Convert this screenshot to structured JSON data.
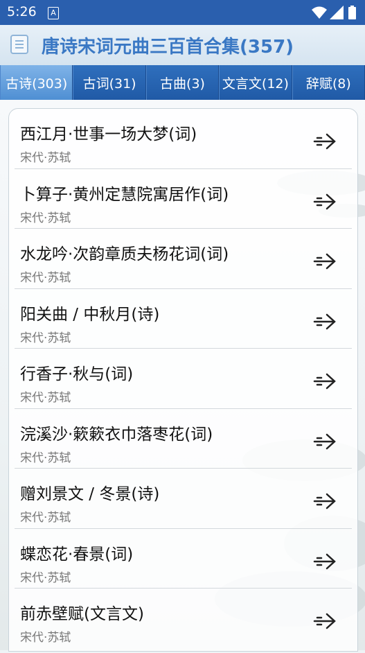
{
  "status_bar": {
    "time": "5:26",
    "notification_icon": "A"
  },
  "app": {
    "title": "唐诗宋词元曲三百首合集(357)"
  },
  "tabs": [
    {
      "label": "古诗(303)",
      "active": true
    },
    {
      "label": "古词(31)",
      "active": false
    },
    {
      "label": "古曲(3)",
      "active": false
    },
    {
      "label": "文言文(12)",
      "active": false
    },
    {
      "label": "辞赋(8)",
      "active": false
    }
  ],
  "items": [
    {
      "title": "西江月·世事一场大梦(词)",
      "author": "宋代·苏轼"
    },
    {
      "title": "卜算子·黄州定慧院寓居作(词)",
      "author": "宋代·苏轼"
    },
    {
      "title": "水龙吟·次韵章质夫杨花词(词)",
      "author": "宋代·苏轼"
    },
    {
      "title": "阳关曲 / 中秋月(诗)",
      "author": "宋代·苏轼"
    },
    {
      "title": "行香子·秋与(词)",
      "author": "宋代·苏轼"
    },
    {
      "title": "浣溪沙·簌簌衣巾落枣花(词)",
      "author": "宋代·苏轼"
    },
    {
      "title": "赠刘景文 / 冬景(诗)",
      "author": "宋代·苏轼"
    },
    {
      "title": "蝶恋花·春景(词)",
      "author": "宋代·苏轼"
    },
    {
      "title": "前赤壁赋(文言文)",
      "author": "宋代·苏轼"
    }
  ],
  "colors": {
    "status_bar": "#2a5fae",
    "tab_bar": "#205aa6",
    "title_text": "#3a78c4"
  }
}
